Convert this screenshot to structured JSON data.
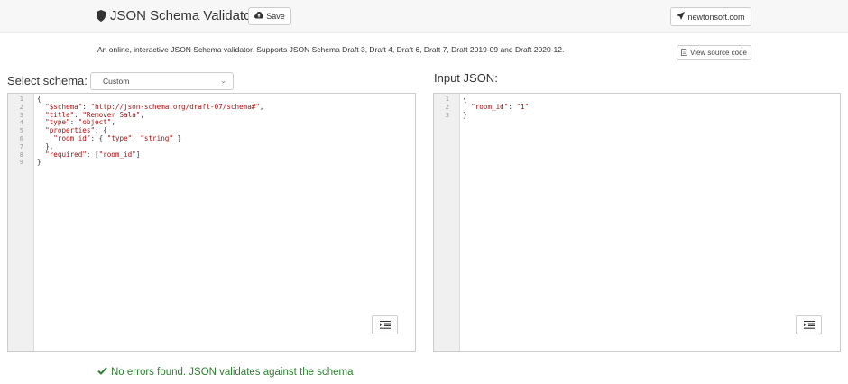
{
  "header": {
    "title": "JSON Schema Validator",
    "save_label": "Save",
    "newtonsoft_label": "newtonsoft.com"
  },
  "intro": {
    "description": "An online, interactive JSON Schema validator. Supports JSON Schema Draft 3, Draft 4, Draft 6, Draft 7, Draft 2019-09 and Draft 2020-12.",
    "view_source_label": "View source code"
  },
  "schema": {
    "select_label": "Select schema:",
    "selected_value": "Custom",
    "line_numbers": [
      "1",
      "2",
      "3",
      "4",
      "5",
      "6",
      "7",
      "8",
      "9"
    ],
    "code_lines": [
      [
        {
          "t": "{",
          "c": "p"
        }
      ],
      [
        {
          "t": "  ",
          "c": "p"
        },
        {
          "t": "\"$schema\"",
          "c": "k"
        },
        {
          "t": ": ",
          "c": "p"
        },
        {
          "t": "\"http://json-schema.org/draft-07/schema#\"",
          "c": "s"
        },
        {
          "t": ",",
          "c": "p"
        }
      ],
      [
        {
          "t": "  ",
          "c": "p"
        },
        {
          "t": "\"title\"",
          "c": "k"
        },
        {
          "t": ": ",
          "c": "p"
        },
        {
          "t": "\"Remover Sala\"",
          "c": "s"
        },
        {
          "t": ",",
          "c": "p"
        }
      ],
      [
        {
          "t": "  ",
          "c": "p"
        },
        {
          "t": "\"type\"",
          "c": "k"
        },
        {
          "t": ": ",
          "c": "p"
        },
        {
          "t": "\"object\"",
          "c": "s"
        },
        {
          "t": ",",
          "c": "p"
        }
      ],
      [
        {
          "t": "  ",
          "c": "p"
        },
        {
          "t": "\"properties\"",
          "c": "k"
        },
        {
          "t": ": {",
          "c": "p"
        }
      ],
      [
        {
          "t": "    ",
          "c": "p"
        },
        {
          "t": "\"room_id\"",
          "c": "k"
        },
        {
          "t": ": { ",
          "c": "p"
        },
        {
          "t": "\"type\"",
          "c": "k"
        },
        {
          "t": ": ",
          "c": "p"
        },
        {
          "t": "\"string\"",
          "c": "s"
        },
        {
          "t": " }",
          "c": "p"
        }
      ],
      [
        {
          "t": "  },",
          "c": "p"
        }
      ],
      [
        {
          "t": "  ",
          "c": "p"
        },
        {
          "t": "\"required\"",
          "c": "k"
        },
        {
          "t": ": [",
          "c": "p"
        },
        {
          "t": "\"room_id\"",
          "c": "s"
        },
        {
          "t": "]",
          "c": "p"
        }
      ],
      [
        {
          "t": "}",
          "c": "p"
        }
      ]
    ]
  },
  "input": {
    "label": "Input JSON:",
    "line_numbers": [
      "1",
      "2",
      "3"
    ],
    "code_lines": [
      [
        {
          "t": "{",
          "c": "p"
        }
      ],
      [
        {
          "t": "  ",
          "c": "p"
        },
        {
          "t": "\"room_id\"",
          "c": "k"
        },
        {
          "t": ": ",
          "c": "p"
        },
        {
          "t": "\"1\"",
          "c": "s"
        }
      ],
      [
        {
          "t": "}",
          "c": "p"
        }
      ]
    ]
  },
  "result": {
    "message": "No errors found. JSON validates against the schema",
    "color": "#2e7d32"
  },
  "icons": {
    "brand": "shield-icon",
    "save": "cloud-upload-icon",
    "newtonsoft": "send-icon",
    "source": "file-icon",
    "format": "indent-icon",
    "status": "check-icon"
  }
}
